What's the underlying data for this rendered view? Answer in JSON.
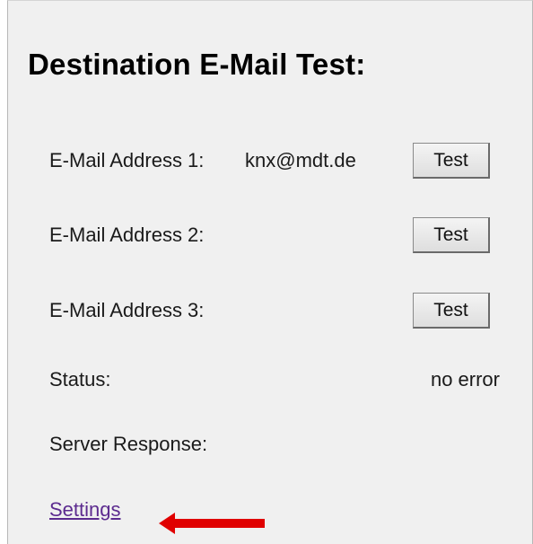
{
  "page": {
    "title": "Destination E-Mail Test:"
  },
  "rows": [
    {
      "label": "E-Mail Address 1:",
      "value": "knx@mdt.de",
      "button_label": "Test"
    },
    {
      "label": "E-Mail Address 2:",
      "value": "",
      "button_label": "Test"
    },
    {
      "label": "E-Mail Address 3:",
      "value": "",
      "button_label": "Test"
    }
  ],
  "status": {
    "label": "Status:",
    "value": "no error"
  },
  "server_response": {
    "label": "Server Response:",
    "value": ""
  },
  "settings_link": {
    "label": "Settings"
  },
  "annotation": {
    "arrow_color": "#e00000",
    "arrow_icon": "left-arrow-icon"
  },
  "colors": {
    "panel_background": "#f0f0f0",
    "link": "#5c2b8f"
  }
}
